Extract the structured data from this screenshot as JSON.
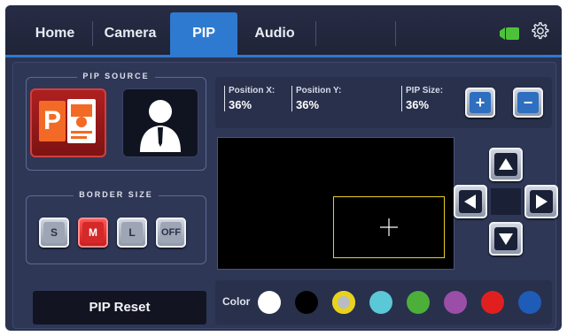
{
  "tabs": [
    {
      "label": "Home"
    },
    {
      "label": "Camera"
    },
    {
      "label": "PIP"
    },
    {
      "label": "Audio"
    }
  ],
  "active_tab": "PIP",
  "pip_source": {
    "title": "PIP SOURCE",
    "options": [
      {
        "name": "ppt-source",
        "selected": true
      },
      {
        "name": "presenter-source",
        "selected": false
      }
    ]
  },
  "border_size": {
    "title": "BORDER SIZE",
    "options": [
      {
        "label": "S"
      },
      {
        "label": "M"
      },
      {
        "label": "L"
      },
      {
        "label": "OFF"
      }
    ],
    "selected": "M"
  },
  "position": {
    "x_label": "Position X:",
    "x_value": "36%",
    "y_label": "Position Y:",
    "y_value": "36%",
    "size_label": "PIP Size:",
    "size_value": "36%"
  },
  "reset_label": "PIP Reset",
  "color": {
    "label": "Color",
    "swatches": [
      "#ffffff",
      "#000000",
      "#e8d21c",
      "#5ac8d6",
      "#4caf3a",
      "#9b4ea8",
      "#e0201f",
      "#1f5cb8"
    ],
    "selected_index": 2
  },
  "colors": {
    "accent": "#2e7ad0",
    "panel": "#2b3350",
    "pip_border": "#e8d021"
  }
}
